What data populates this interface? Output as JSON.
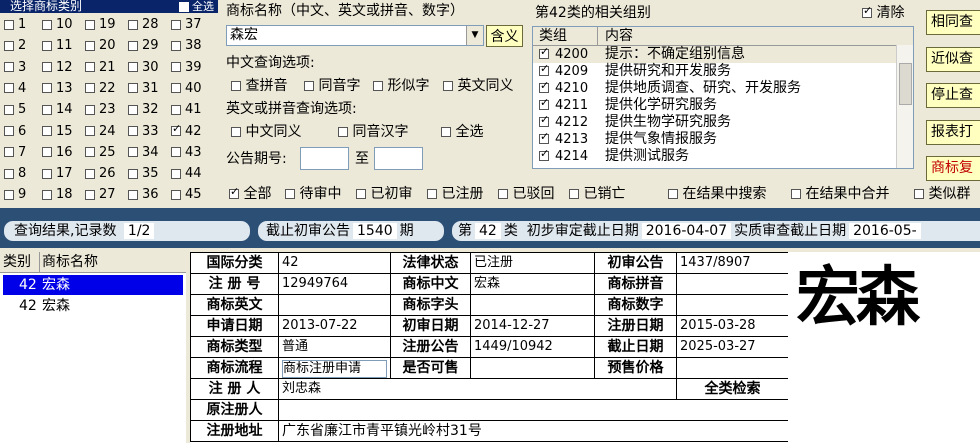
{
  "class_panel": {
    "title": "选择商标类别",
    "select_all": "全选",
    "columns": [
      [
        "1",
        "2",
        "3",
        "4",
        "5",
        "6",
        "7",
        "8",
        "9"
      ],
      [
        "10",
        "11",
        "12",
        "13",
        "14",
        "15",
        "16",
        "17",
        "18"
      ],
      [
        "19",
        "20",
        "21",
        "22",
        "23",
        "24",
        "25",
        "26",
        "27"
      ],
      [
        "28",
        "29",
        "30",
        "31",
        "32",
        "33",
        "34",
        "35",
        "36"
      ],
      [
        "37",
        "38",
        "39",
        "40",
        "41",
        "42",
        "43",
        "44",
        "45"
      ]
    ],
    "checked": [
      "42"
    ]
  },
  "query": {
    "name_label": "商标名称（中文、英文或拼音、数字）",
    "name_value": "森宏",
    "meaning_button": "含义",
    "cn_label": "中文查询选项:",
    "cn_options": [
      "查拼音",
      "同音字",
      "形似字",
      "英文同义"
    ],
    "en_label": "英文或拼音查询选项:",
    "en_options": [
      "中文同义",
      "同音汉字",
      "全选"
    ],
    "period_label": "公告期号:",
    "period_to": "至",
    "period_from_value": "",
    "period_to_value": ""
  },
  "groups": {
    "title": "第42类的相关组别",
    "clear_label": "清除",
    "clear_checked": true,
    "col_group": "类组",
    "col_content": "内容",
    "rows": [
      {
        "code": "4200",
        "text": "提示：不确定组别信息"
      },
      {
        "code": "4209",
        "text": "提供研究和开发服务"
      },
      {
        "code": "4210",
        "text": "提供地质调查、研究、开发服务"
      },
      {
        "code": "4211",
        "text": "提供化学研究服务"
      },
      {
        "code": "4212",
        "text": "提供生物学研究服务"
      },
      {
        "code": "4213",
        "text": "提供气象情报服务"
      },
      {
        "code": "4214",
        "text": "提供测试服务"
      }
    ]
  },
  "side_buttons": [
    "相同查",
    "近似查",
    "停止查",
    "报表打",
    "商标复"
  ],
  "filters": {
    "items": [
      {
        "label": "全部",
        "checked": true
      },
      {
        "label": "待审中",
        "checked": false
      },
      {
        "label": "已初审",
        "checked": false
      },
      {
        "label": "已注册",
        "checked": false
      },
      {
        "label": "已驳回",
        "checked": false
      },
      {
        "label": "已销亡",
        "checked": false
      }
    ],
    "extra": [
      "在结果中搜索",
      "在结果中合并",
      "类似群"
    ]
  },
  "status_bar": {
    "result_label": "查询结果,记录数",
    "result_value": "1/2",
    "cutoff_label": "截止初审公告",
    "cutoff_value": "1540",
    "cutoff_unit": "期",
    "class_prefix": "第",
    "class_value": "42",
    "class_suffix": "类",
    "initial_label": "初步审定截止日期",
    "initial_value": "2016-04-07",
    "substantive_label": "实质审查截止日期",
    "substantive_value": "2016-05-"
  },
  "results_list": {
    "col_class": "类别",
    "col_name": "商标名称",
    "rows": [
      {
        "class": "42",
        "name": "宏森",
        "selected": true
      },
      {
        "class": "42",
        "name": "宏森",
        "selected": false
      }
    ]
  },
  "detail": {
    "intl_class_k": "国际分类",
    "intl_class_v": "42",
    "legal_status_k": "法律状态",
    "legal_status_v": "已注册",
    "prelim_pub_k": "初审公告",
    "prelim_pub_v": "1437/8907",
    "reg_no_k": "注 册 号",
    "reg_no_v": "12949764",
    "cn_name_k": "商标中文",
    "cn_name_v": "宏森",
    "pinyin_k": "商标拼音",
    "pinyin_v": "",
    "en_name_k": "商标英文",
    "en_name_v": "",
    "initials_k": "商标字头",
    "initials_v": "",
    "digits_k": "商标数字",
    "digits_v": "",
    "apply_date_k": "申请日期",
    "apply_date_v": "2013-07-22",
    "prelim_date_k": "初审日期",
    "prelim_date_v": "2014-12-27",
    "reg_date_k": "注册日期",
    "reg_date_v": "2015-03-28",
    "type_k": "商标类型",
    "type_v": "普通",
    "reg_pub_k": "注册公告",
    "reg_pub_v": "1449/10942",
    "expiry_k": "截止日期",
    "expiry_v": "2025-03-27",
    "flow_k": "商标流程",
    "flow_v": "商标注册申请",
    "presale_k": "是否可售",
    "presale_v": "",
    "price_k": "预售价格",
    "price_v": "",
    "registrant_k": "注 册 人",
    "registrant_v": "刘忠森",
    "full_search": "全类检索",
    "orig_registrant_k": "原注册人",
    "orig_registrant_v": "",
    "address_k": "注册地址",
    "address_v": "广东省廉江市青平镇光岭村31号"
  },
  "logo_text": "宏森"
}
